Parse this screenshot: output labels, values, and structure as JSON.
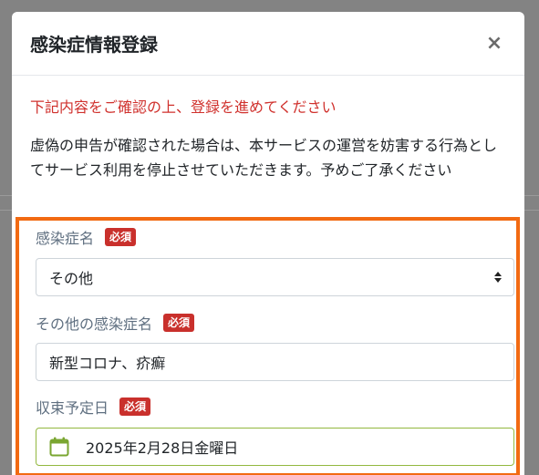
{
  "modal": {
    "title": "感染症情報登録",
    "close_label": "×",
    "notice_red": "下記内容をご確認の上、登録を進めてください",
    "notice_text": "虚偽の申告が確認された場合は、本サービスの運営を妨害する行為としてサービス利用を停止させていただきます。予めご了承ください"
  },
  "form": {
    "required_label": "必須",
    "disease": {
      "label": "感染症名",
      "value": "その他"
    },
    "other_disease": {
      "label": "その他の感染症名",
      "value": "新型コロナ、疥癬"
    },
    "end_date": {
      "label": "収束予定日",
      "value": "2025年2月28日金曜日"
    }
  },
  "colors": {
    "highlight_border": "#f26a12",
    "notice_red": "#d0312d",
    "badge": "#c9302c",
    "date_border": "#93b83f",
    "calendar_icon": "#7aa631"
  },
  "icons": {
    "close": "close-icon",
    "select": "select-arrows-icon",
    "calendar": "calendar-icon"
  }
}
